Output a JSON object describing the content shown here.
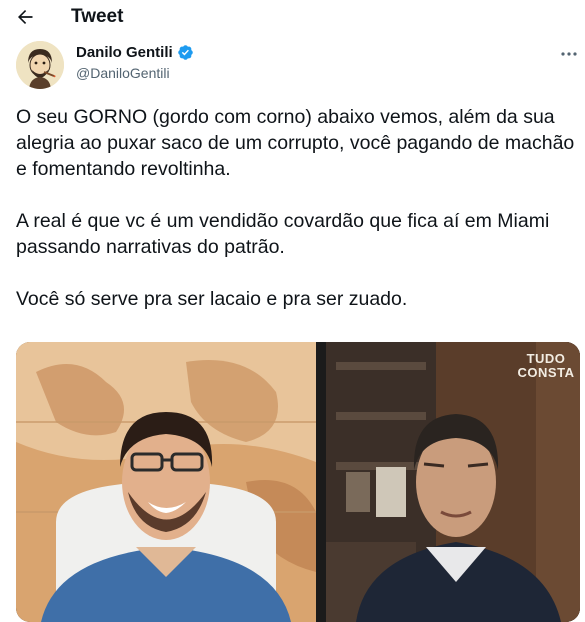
{
  "header": {
    "title": "Tweet",
    "back_icon": "arrow-left-icon"
  },
  "author": {
    "name": "Danilo Gentili",
    "handle": "@DaniloGentili",
    "verified": true,
    "verified_color": "#1d9bf0"
  },
  "tweet": {
    "paragraphs": [
      "O seu GORNO (gordo com corno) abaixo vemos, além da sua alegria ao puxar saco de um corrupto, você pagando de machão e fomentando revoltinha.",
      "A real é que vc é um vendidão covardão que fica aí em Miami passando narrativas do patrão.",
      "Você só serve pra ser lacaio e pra ser zuado."
    ]
  },
  "media": {
    "watermark_line1": "TUDO",
    "watermark_line2": "CONSTA"
  },
  "colors": {
    "text": "#0f1419",
    "secondary": "#536471",
    "accent": "#1d9bf0"
  }
}
